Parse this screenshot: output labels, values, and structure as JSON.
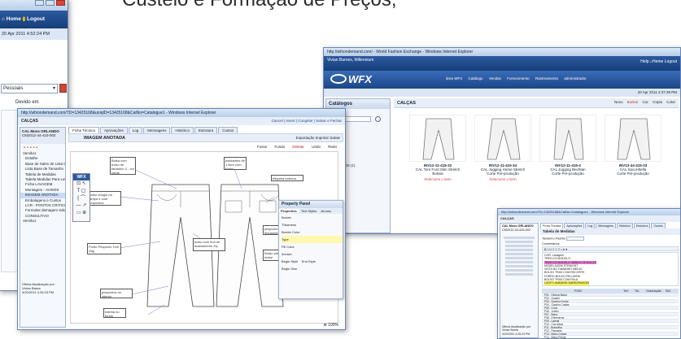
{
  "heading": "Custeio e Formação de Preços;",
  "left_window": {
    "home": "Home",
    "logout": "Logout",
    "date": "20 Apr 2011 4:52:24 PM",
    "select_value": "Pessoais",
    "devido": "Devido em"
  },
  "wfx_window": {
    "title": "http://wfxondemand.com/ - World Fashion Exchange - Windows Internet Explorer",
    "user": "Vivian Barnes, Millennium",
    "help": "Help",
    "home": "Home",
    "logout": "Logout",
    "logo": "WFX",
    "nav": [
      "área WFX",
      "Catálogo",
      "Vendas",
      "Fornecimento",
      "Rastreamento",
      "administrador"
    ],
    "date": "20 Apr 2011 4:37:39 PM",
    "sidebar_title": "Catálogos",
    "search_label": "Search",
    "sidebar_items": [
      "ATAS (1)",
      "TAS (2)",
      "RAS (0)",
      "VESTIDOS (1)"
    ],
    "section_title": "CALÇAS",
    "toolbar": [
      "Novo",
      "Excluir",
      "Cor",
      "Copia",
      "Color"
    ],
    "products": [
      {
        "code": "INV12-11-415-32",
        "desc": "CAL Tom Ford Slim Stretch",
        "status": "Bolivia"
      },
      {
        "code": "INV12-11-415-34",
        "desc": "CAL Jogging Home Stretch",
        "status": "Corte Pré-produção"
      },
      {
        "code": "INV12-11-415-4",
        "desc": "CAL Jogging Bechtan",
        "status": "Corte Pré-produção"
      },
      {
        "code": "INV13-44-415-33",
        "desc": "CAL Sacul-Bella",
        "status": "Corte Pré-produção"
      }
    ],
    "select_label": "Selecione o item"
  },
  "main_window": {
    "title": "http://wfxondemand.com/TD=13425168&uniqID=13425168&CatNo=Catalogue1 - Windows Internet Explorer",
    "breadcrumb": "CALÇAS",
    "header_actions": [
      "Cancel",
      "Insert",
      "Congelar",
      "Salvar e Fechar"
    ],
    "product_name": "CAL Moss ORLANDO",
    "product_code": "CM2012-44-415-002",
    "tabs": [
      "Ficha Técnica",
      "Aprovações",
      "Log",
      "Mensagens",
      "Histórico",
      "Estrutura",
      "Custos"
    ],
    "tree": [
      "Versão1",
      "Detalhe",
      "Base de Sales de Lista Cal",
      "Lista Base de Tamanho",
      "Tabela de Medidas",
      "Tabela Medidas Para Lavage",
      "Ficha LAVAGEM",
      "Montagem - AVISOS",
      "IMAGEM ANOTADA",
      "Embalagens e Custos",
      "LCR - PONTOS CRITICOS",
      "Formulas damagem sido sm",
      "CONSULTIVO",
      "Versão1"
    ],
    "footer": [
      "Última Atualização por:",
      "Vivian Barna",
      "4/20/2011 4:25:23 PM"
    ],
    "image_title": "IMAGEM ANOTADA",
    "image_actions": [
      "Exportação",
      "Imprimir",
      "Salvar"
    ],
    "draw_actions": [
      "Fosse",
      "Fundo",
      "Deletar",
      "Undo",
      "Redo"
    ],
    "notes": [
      "Bolsa com bolso de tamanho 3 - cor verde",
      "Bolso relogio na tampa e com pespontos",
      "passantes de 1.5cm com botao",
      "etiqueta externa",
      "pesponto no fechamento",
      "Botao pressao metal",
      "bolso com fino de acabamento Zip",
      "Ponto Pesponto 1cm Zag",
      "pespontos no interior",
      "bainha ou fundo"
    ],
    "tool_label": "WFX",
    "property_title": "Property Panel",
    "property_tabs": [
      "Properties",
      "Text Styles",
      "Arrows"
    ],
    "property_rows": [
      "Border",
      "Thickness",
      "Border Color",
      "Type",
      "Fill Color",
      "Arrows",
      "Begin Style",
      "End Style",
      "Begin Size"
    ],
    "zoom": "100%"
  },
  "third_window": {
    "title": "http://wfxondemand.com/TD=13425168&CatNo=Catalogue1 - Windows Internet Explorer",
    "breadcrumb": "CALÇAS",
    "product_name": "CAL Moss ORLANDO",
    "product_code": "CM2012-44-415-002",
    "tabs": [
      "Ficha Técnica",
      "Aprovações",
      "Log",
      "Mensagens",
      "Histórico",
      "Estrutura",
      "Custos"
    ],
    "table_title": "Tabela de Medidas",
    "size_label": "Tamanho Padrão",
    "comments": "Comentários",
    "highlight_lines": [
      "TRES DO MODELO: BISIKO DE BOLSO",
      "LIGHT LAVAGEM: DARKORAGON"
    ],
    "lines": [
      "COR: Lavagem",
      "TRES DO MODELO:",
      "MODELAGEM STRAIGHT",
      "VISTA NO TAMANHO MEDIO",
      "BOLSO TRAS COM RECORTE",
      "FORRO BOLSO PELUGEM",
      "BOLSO TRAS COM PALA",
      "COR DE PEDIDOS"
    ],
    "table_columns": [
      "POM",
      "Tol+",
      "Tol-",
      "Graduação",
      "Std"
    ],
    "table_rows": [
      "P01 - Cintura Baixa",
      "P02 - Quadril",
      "P03 - Gancho Frente",
      "P04 - Gancho Costas",
      "P05 - Coxa",
      "P06 - Joelho",
      "P07 - Barra",
      "P08 - Entreperna",
      "P09 - Lateral",
      "P10 - Cós Altura",
      "P11 - Braguilha",
      "P12 - Passante",
      "P13 - Bolso Costas",
      "P14 - Bolso Frente"
    ],
    "footer": [
      "Última Atualização por:",
      "Vivian Barna",
      "4/20/2011 4:25:23 PM"
    ]
  }
}
